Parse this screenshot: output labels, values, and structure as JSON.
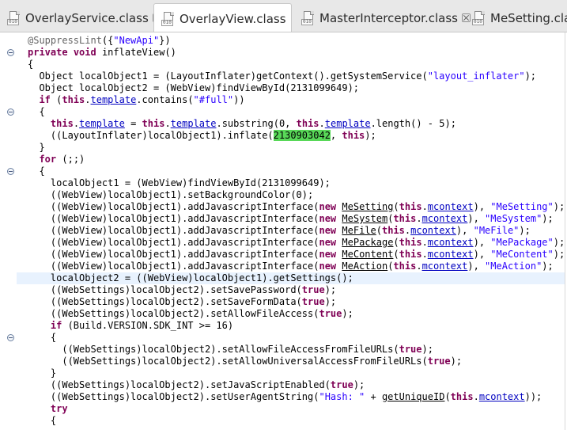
{
  "tabs": [
    {
      "label": "OverlayService.class",
      "active": false
    },
    {
      "label": "OverlayView.class",
      "active": true
    },
    {
      "label": "MasterInterceptor.class",
      "active": false
    },
    {
      "label": "MeSetting.class",
      "active": false
    }
  ],
  "code": {
    "lines": [
      "@SuppressLint({\"NewApi\"})",
      "private void inflateView()",
      "{",
      "  Object localObject1 = (LayoutInflater)getContext().getSystemService(\"layout_inflater\");",
      "  Object localObject2 = (WebView)findViewById(2131099649);",
      "  if (this.template.contains(\"#full\"))",
      "  {",
      "    this.template = this.template.substring(0, this.template.length() - 5);",
      "    ((LayoutInflater)localObject1).inflate(2130903042, this);",
      "  }",
      "  for (;;)",
      "  {",
      "    localObject1 = (WebView)findViewById(2131099649);",
      "    ((WebView)localObject1).setBackgroundColor(0);",
      "    ((WebView)localObject1).addJavascriptInterface(new MeSetting(this.mcontext), \"MeSetting\");",
      "    ((WebView)localObject1).addJavascriptInterface(new MeSystem(this.mcontext), \"MeSystem\");",
      "    ((WebView)localObject1).addJavascriptInterface(new MeFile(this.mcontext), \"MeFile\");",
      "    ((WebView)localObject1).addJavascriptInterface(new MePackage(this.mcontext), \"MePackage\");",
      "    ((WebView)localObject1).addJavascriptInterface(new MeContent(this.mcontext), \"MeContent\");",
      "    ((WebView)localObject1).addJavascriptInterface(new MeAction(this.mcontext), \"MeAction\");",
      "    localObject2 = ((WebView)localObject1).getSettings();",
      "    ((WebSettings)localObject2).setSavePassword(true);",
      "    ((WebSettings)localObject2).setSaveFormData(true);",
      "    ((WebSettings)localObject2).setAllowFileAccess(true);",
      "    if (Build.VERSION.SDK_INT >= 16)",
      "    {",
      "      ((WebSettings)localObject2).setAllowFileAccessFromFileURLs(true);",
      "      ((WebSettings)localObject2).setAllowUniversalAccessFromFileURLs(true);",
      "    }",
      "    ((WebSettings)localObject2).setJavaScriptEnabled(true);",
      "    ((WebSettings)localObject2).setUserAgentString(\"Hash: \" + getUniqueID(this.mcontext));",
      "    try",
      "    {"
    ],
    "current_line_index": 20,
    "highlighted_token": "2130903042",
    "fold_marker_lines": [
      1,
      6,
      11,
      25
    ]
  },
  "colors": {
    "keyword": "#7f0055",
    "string": "#2a00ff",
    "field": "#0000c0",
    "annotation": "#646464",
    "occurrence_highlight": "#58d858",
    "current_line": "#e8f2fe"
  },
  "icons": {
    "tab_file": "class-file-icon",
    "tab_close": "close-icon",
    "fold": "fold-collapse-icon"
  }
}
